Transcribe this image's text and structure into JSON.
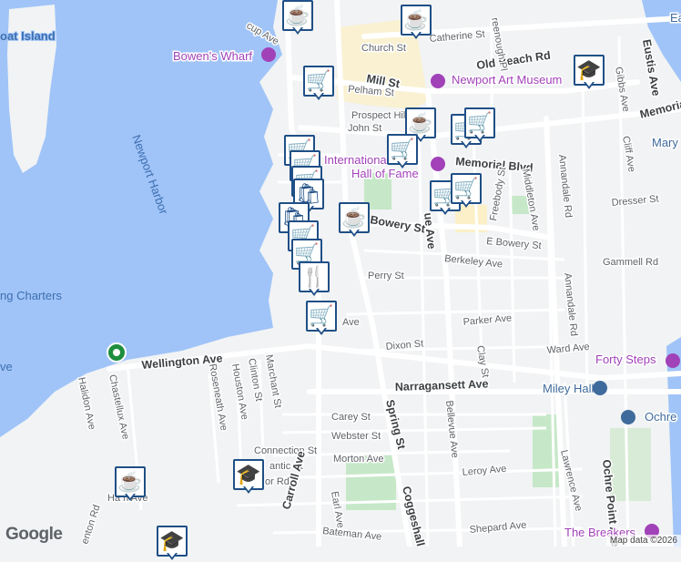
{
  "colors": {
    "water": "#a0c4f8",
    "land": "#f1f3f4",
    "park": "#c6e8c8",
    "road": "#ffffff",
    "sand": "#fbf0c8",
    "marker": "#1f4f86",
    "museum": "#a142b8",
    "education": "#3f6b9c"
  },
  "water_labels": {
    "island": "oat Island",
    "harbor": "Newport Harbor",
    "charters": "ng Charters",
    "ve": "ve"
  },
  "poi_labels": {
    "bowens_wharf": "Bowen's Wharf",
    "art_museum": "Newport Art Museum",
    "hall_of_fame_1": "International",
    "hall_of_fame_2": "Hall of Fame",
    "forty_steps": "Forty Steps",
    "miley_hall": "Miley Hall",
    "ochre": "Ochre",
    "breakers": "The Breakers",
    "mary": "Mary",
    "ea": "Ea"
  },
  "streets": {
    "church": "Church St",
    "catherine": "Catherine St",
    "old_beach": "Old Beach Rd",
    "mill": "Mill St",
    "pelham": "Pelham St",
    "prospect": "Prospect Hill",
    "john": "John St",
    "memorial": "Memorial Blvd",
    "memorial2": "Memorial",
    "bowery": "Bowery St",
    "e_bowery": "E Bowery St",
    "berkeley": "Berkeley Ave",
    "perry": "Perry St",
    "dixon": "Dixon St",
    "parker": "Parker Ave",
    "ward": "Ward Ave",
    "narragansett": "Narragansett Ave",
    "wellington": "Wellington Ave",
    "carey": "Carey St",
    "webster": "Webster St",
    "connection": "Connection St",
    "antic": "antic St",
    "morton": "Morton Ave",
    "leroy": "Leroy Ave",
    "shepard": "Shepard Ave",
    "bateman": "Bateman Ave",
    "harrison": "Ha     n Ave",
    "spring": "Spring St",
    "bellevue": "Bellevue Ave",
    "coggeshall": "Coggeshall",
    "carroll": "Carroll Ave",
    "earl": "Earl Ave",
    "halidon": "Halidon Ave",
    "chastellux": "Chastellux Ave",
    "roseneath": "Roseneath Ave",
    "houston": "Houston Ave",
    "clinton": "Clinton St",
    "marchant": "Marchant St",
    "annandale": "Annandale Rd",
    "freebody": "Freebody St",
    "middleton": "Middleton Ave",
    "dresser": "Dresser St",
    "gammell": "Gammell Rd",
    "clay": "Clay St",
    "lawrence": "Lawrence Ave",
    "ochre_point": "Ochre Point Ave",
    "eustis": "Eustis Ave",
    "gibbs": "Gibbs Ave",
    "cliff": "Cliff Ave",
    "greenough": "reenough Pl",
    "thames_top": "cup Ave",
    "ue_ave": "ue Ave",
    "ave_short": "Ave",
    "or_rd": "or Rd",
    "enton_rd": "enton Rd"
  },
  "markers": [
    {
      "icon": "☕",
      "kind": "cafe"
    },
    {
      "icon": "☕",
      "kind": "cafe"
    },
    {
      "icon": "🛒",
      "kind": "shopping"
    },
    {
      "icon": "☕",
      "kind": "cafe"
    },
    {
      "icon": "🛒",
      "kind": "shopping"
    },
    {
      "icon": "🛒",
      "kind": "shopping"
    },
    {
      "icon": "🛒",
      "kind": "shopping"
    },
    {
      "icon": "🛒",
      "kind": "shopping"
    },
    {
      "icon": "🛒",
      "kind": "shopping"
    },
    {
      "icon": "🛒",
      "kind": "shopping"
    },
    {
      "icon": "🛒",
      "kind": "shopping"
    },
    {
      "icon": "☕",
      "kind": "cafe"
    },
    {
      "icon": "🛍",
      "kind": "store"
    },
    {
      "icon": "🛒",
      "kind": "shopping"
    },
    {
      "icon": "🛍",
      "kind": "store"
    },
    {
      "icon": "🛒",
      "kind": "shopping"
    },
    {
      "icon": "🛒",
      "kind": "shopping"
    },
    {
      "icon": "🍴",
      "kind": "restaurant"
    },
    {
      "icon": "🛒",
      "kind": "shopping"
    },
    {
      "icon": "☕",
      "kind": "cafe"
    },
    {
      "icon": "🎓",
      "kind": "school"
    },
    {
      "icon": "🎓",
      "kind": "school"
    },
    {
      "icon": "🎓",
      "kind": "school"
    }
  ],
  "attribution": "Map data ©2026",
  "logo": "Google"
}
